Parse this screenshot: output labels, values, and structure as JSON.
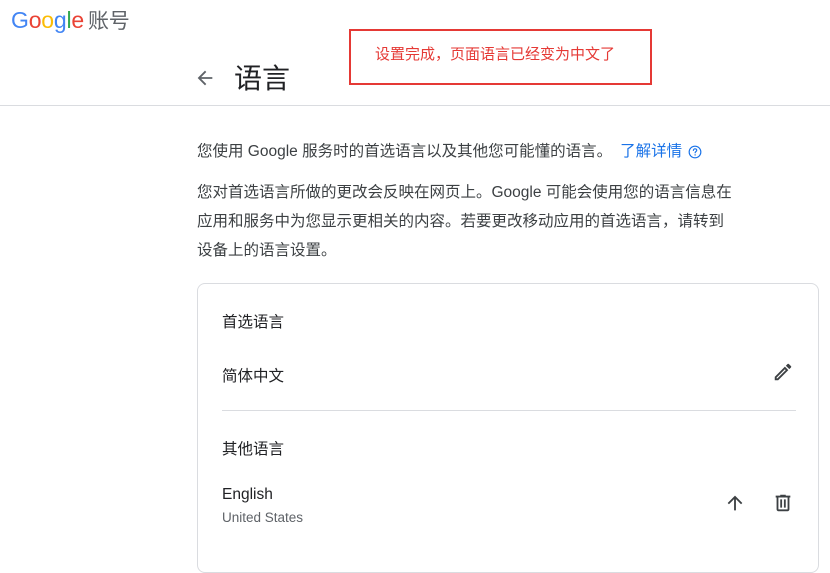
{
  "header": {
    "logo_text": "Google",
    "account_label": "账号",
    "title": "语言"
  },
  "annotation": {
    "text": "设置完成，页面语言已经变为中文了",
    "color": "#e53935"
  },
  "intro": {
    "text": "您使用 Google 服务时的首选语言以及其他您可能懂的语言。",
    "learn_more": "了解详情",
    "paragraph_lines": [
      "您对首选语言所做的更改会反映在网页上。Google 可能会使用您的语言信息在",
      "应用和服务中为您显示更相关的内容。若要更改移动应用的首选语言，请转到",
      "设备上的语言设置。"
    ]
  },
  "preferred": {
    "label": "首选语言",
    "language": "简体中文"
  },
  "other": {
    "label": "其他语言",
    "languages": [
      {
        "name": "English",
        "region": "United States"
      }
    ]
  },
  "colors": {
    "link": "#1a73e8",
    "text": "#202124",
    "secondary": "#5f6368",
    "divider": "#dadce0"
  },
  "icons": [
    "arrow-back-icon",
    "help-icon",
    "edit-pencil-icon",
    "arrow-up-icon",
    "delete-icon"
  ]
}
